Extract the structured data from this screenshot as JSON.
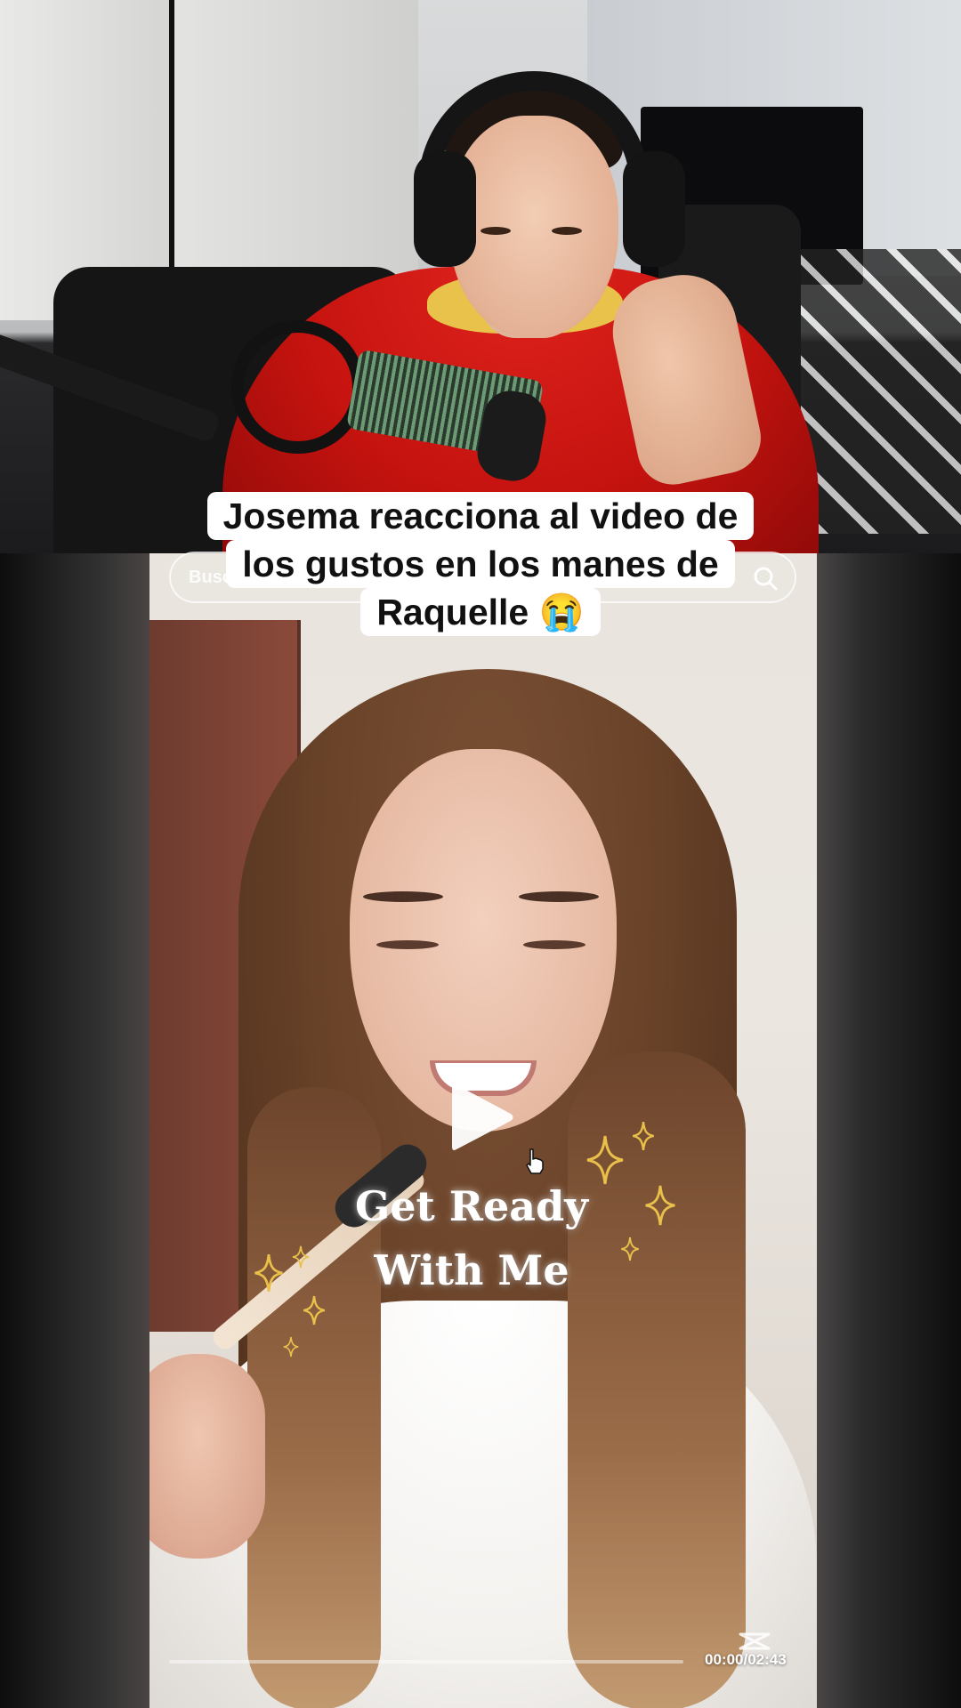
{
  "caption": {
    "line1": "Josema reacciona al video de",
    "line2": "los gustos en los manes de",
    "line3": "Raquelle 😭"
  },
  "embed": {
    "search_placeholder": "Busc",
    "overlay_title_line1": "Get Ready",
    "overlay_title_line2": "With Me",
    "time_display": "00:00/02:43",
    "progress_fraction": 0.0
  },
  "icons": {
    "search": "search-icon",
    "play": "play-icon",
    "cursor": "hand-cursor-icon",
    "sparkle": "sparkle-icon",
    "watermark": "capcut-logo-icon"
  },
  "colors": {
    "caption_bg": "#ffffff",
    "caption_text": "#111111",
    "sparkle": "#e8c04a",
    "hoodie": "#d01812"
  }
}
